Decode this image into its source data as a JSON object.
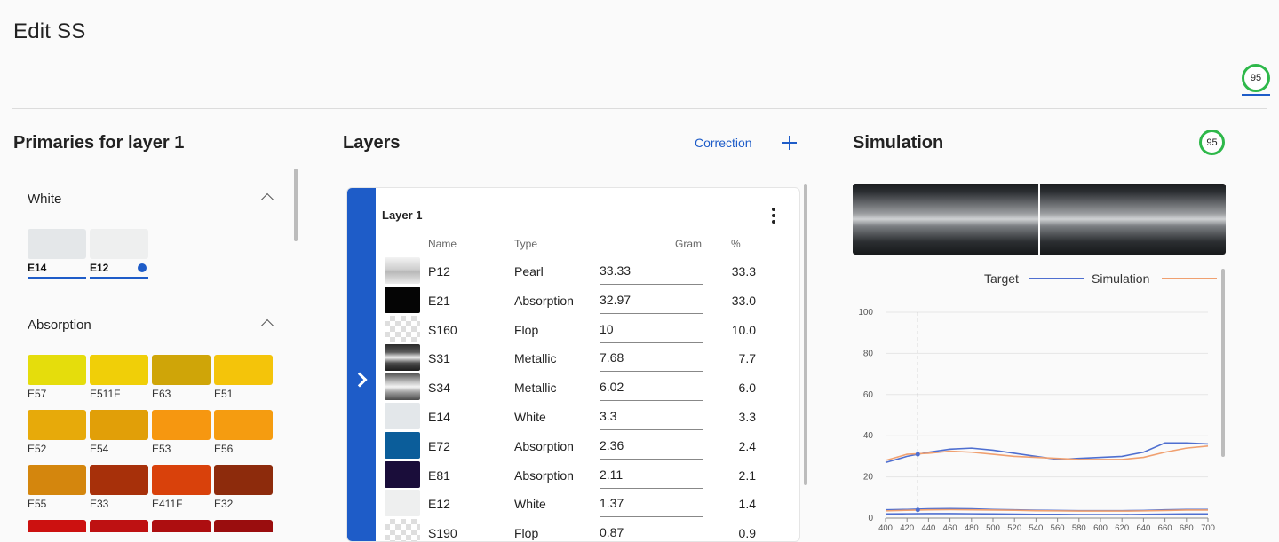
{
  "header": {
    "title": "Edit  SS",
    "score": "95"
  },
  "primaries": {
    "title": "Primaries for layer 1",
    "groups": [
      {
        "name": "White",
        "items": [
          {
            "code": "E14",
            "color": "#e4e7e9",
            "selected": false
          },
          {
            "code": "E12",
            "color": "#eeefef",
            "selected": true
          }
        ]
      },
      {
        "name": "Absorption",
        "items": [
          {
            "code": "E57",
            "color": "#e5dd0c"
          },
          {
            "code": "E511F",
            "color": "#f0cf08"
          },
          {
            "code": "E63",
            "color": "#cfa508"
          },
          {
            "code": "E51",
            "color": "#f4c40a"
          },
          {
            "code": "E52",
            "color": "#e7aa0a"
          },
          {
            "code": "E54",
            "color": "#e19f08"
          },
          {
            "code": "E53",
            "color": "#f69710"
          },
          {
            "code": "E56",
            "color": "#f59c10"
          },
          {
            "code": "E55",
            "color": "#d4860d"
          },
          {
            "code": "E33",
            "color": "#a7300a"
          },
          {
            "code": "E411F",
            "color": "#d9410b"
          },
          {
            "code": "E32",
            "color": "#8d2b0c"
          },
          {
            "code": "",
            "color": "#cc1110"
          },
          {
            "code": "",
            "color": "#be1112"
          },
          {
            "code": "",
            "color": "#ad0e10"
          },
          {
            "code": "",
            "color": "#9a0d0e"
          }
        ]
      }
    ]
  },
  "layers": {
    "title": "Layers",
    "correction_label": "Correction",
    "layer_title": "Layer 1",
    "columns": {
      "name": "Name",
      "type": "Type",
      "gram": "Gram",
      "pct": "%"
    },
    "rows": [
      {
        "name": "P12",
        "type": "Pearl",
        "gram": "33.33",
        "pct": "33.3",
        "swatch": "pearl"
      },
      {
        "name": "E21",
        "type": "Absorption",
        "gram": "32.97",
        "pct": "33.0",
        "swatch": "black"
      },
      {
        "name": "S160",
        "type": "Flop",
        "gram": "10",
        "pct": "10.0",
        "swatch": "checker"
      },
      {
        "name": "S31",
        "type": "Metallic",
        "gram": "7.68",
        "pct": "7.7",
        "swatch": "metal-dark"
      },
      {
        "name": "S34",
        "type": "Metallic",
        "gram": "6.02",
        "pct": "6.0",
        "swatch": "metal-light"
      },
      {
        "name": "E14",
        "type": "White",
        "gram": "3.3",
        "pct": "3.3",
        "swatch": "white-cool"
      },
      {
        "name": "E72",
        "type": "Absorption",
        "gram": "2.36",
        "pct": "2.4",
        "swatch": "blue"
      },
      {
        "name": "E81",
        "type": "Absorption",
        "gram": "2.11",
        "pct": "2.1",
        "swatch": "violet"
      },
      {
        "name": "E12",
        "type": "White",
        "gram": "1.37",
        "pct": "1.4",
        "swatch": "white"
      },
      {
        "name": "S190",
        "type": "Flop",
        "gram": "0.87",
        "pct": "0.9",
        "swatch": "checker"
      }
    ]
  },
  "simulation": {
    "title": "Simulation",
    "score": "95",
    "colors": {
      "target": "#4f6fd0",
      "simulation": "#f0a070"
    }
  },
  "chart_data": {
    "type": "line",
    "legend": [
      "Target",
      "Simulation"
    ],
    "legend_position": "top-right",
    "x": [
      400,
      420,
      440,
      460,
      480,
      500,
      520,
      540,
      560,
      580,
      600,
      620,
      640,
      660,
      680,
      700
    ],
    "xlim": [
      400,
      700
    ],
    "ylim": [
      0,
      100
    ],
    "yticks": [
      0,
      20,
      40,
      60,
      80,
      100
    ],
    "cursor_x": 430,
    "series": [
      {
        "name": "Target",
        "values": [
          27,
          30,
          32,
          33.5,
          34,
          33,
          31.5,
          30,
          28.5,
          29,
          29.5,
          30,
          32,
          36.5,
          36.5,
          36
        ]
      },
      {
        "name": "Simulation",
        "values": [
          28,
          31,
          31.5,
          32.5,
          32,
          31,
          30,
          29.5,
          29,
          28.5,
          28.5,
          28.5,
          29.5,
          32,
          34,
          35
        ]
      },
      {
        "name": "Target",
        "values": [
          4,
          4.2,
          4.5,
          4.6,
          4.5,
          4.2,
          4.0,
          3.8,
          3.7,
          3.6,
          3.6,
          3.6,
          3.7,
          4.0,
          4.2,
          4.2
        ]
      },
      {
        "name": "Simulation",
        "values": [
          3.5,
          3.8,
          4.0,
          4.1,
          4.0,
          3.9,
          3.8,
          3.6,
          3.5,
          3.4,
          3.4,
          3.4,
          3.5,
          3.7,
          3.9,
          3.9
        ]
      },
      {
        "name": "Target",
        "values": [
          2.0,
          2.1,
          2.2,
          2.2,
          2.1,
          2.0,
          1.9,
          1.8,
          1.8,
          1.7,
          1.7,
          1.7,
          1.8,
          1.9,
          2.0,
          2.0
        ]
      }
    ]
  }
}
